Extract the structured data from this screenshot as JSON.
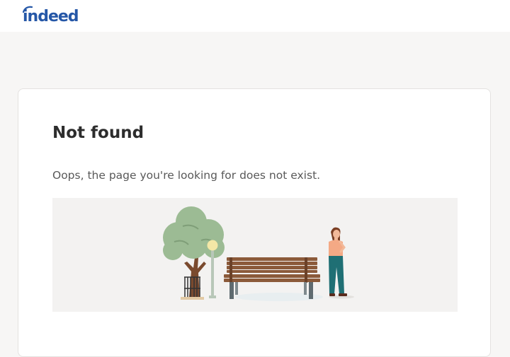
{
  "header": {
    "logo_text": "indeed"
  },
  "main": {
    "title": "Not found",
    "message": "Oops, the page you're looking for does not exist."
  },
  "colors": {
    "brand": "#2557a7",
    "page_background": "#f7f6f5",
    "illustration_background": "#f3f2f1"
  }
}
